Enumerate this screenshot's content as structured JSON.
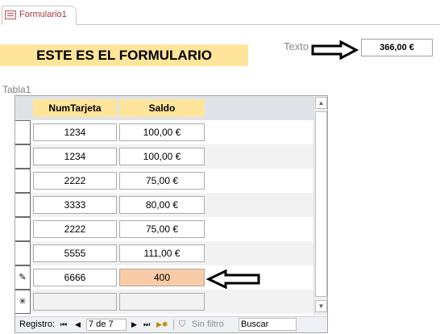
{
  "tab": {
    "label": "Formulario1"
  },
  "header": {
    "title": "ESTE ES EL FORMULARIO",
    "texto_label": "Texto",
    "texto_value": "366,00 €"
  },
  "subform": {
    "name": "Tabla1",
    "columns": [
      "NumTarjeta",
      "Saldo"
    ],
    "rows": [
      {
        "selector": "",
        "numtarjeta": "1234",
        "saldo": "100,00 €"
      },
      {
        "selector": "",
        "numtarjeta": "1234",
        "saldo": "100,00 €"
      },
      {
        "selector": "",
        "numtarjeta": "2222",
        "saldo": "75,00 €"
      },
      {
        "selector": "",
        "numtarjeta": "3333",
        "saldo": "80,00 €"
      },
      {
        "selector": "",
        "numtarjeta": "2222",
        "saldo": "75,00 €"
      },
      {
        "selector": "",
        "numtarjeta": "5555",
        "saldo": "111,00 €"
      },
      {
        "selector": "✎",
        "numtarjeta": "6666",
        "saldo": "400"
      },
      {
        "selector": "✳",
        "numtarjeta": "",
        "saldo": ""
      }
    ]
  },
  "navigation": {
    "label": "Registro:",
    "first": "⏮",
    "prev": "◀",
    "position": "7 de 7",
    "next": "▶",
    "last": "⏭",
    "new": "▶✱",
    "filter": "Sin filtro",
    "search": "Buscar"
  },
  "icons": {
    "tab_icon": "form-icon",
    "arrow": "arrow-left-icon"
  },
  "colors": {
    "title_bg": "#ffe49c",
    "highlight": "#f9cba6",
    "tab_text": "#a4373a"
  }
}
